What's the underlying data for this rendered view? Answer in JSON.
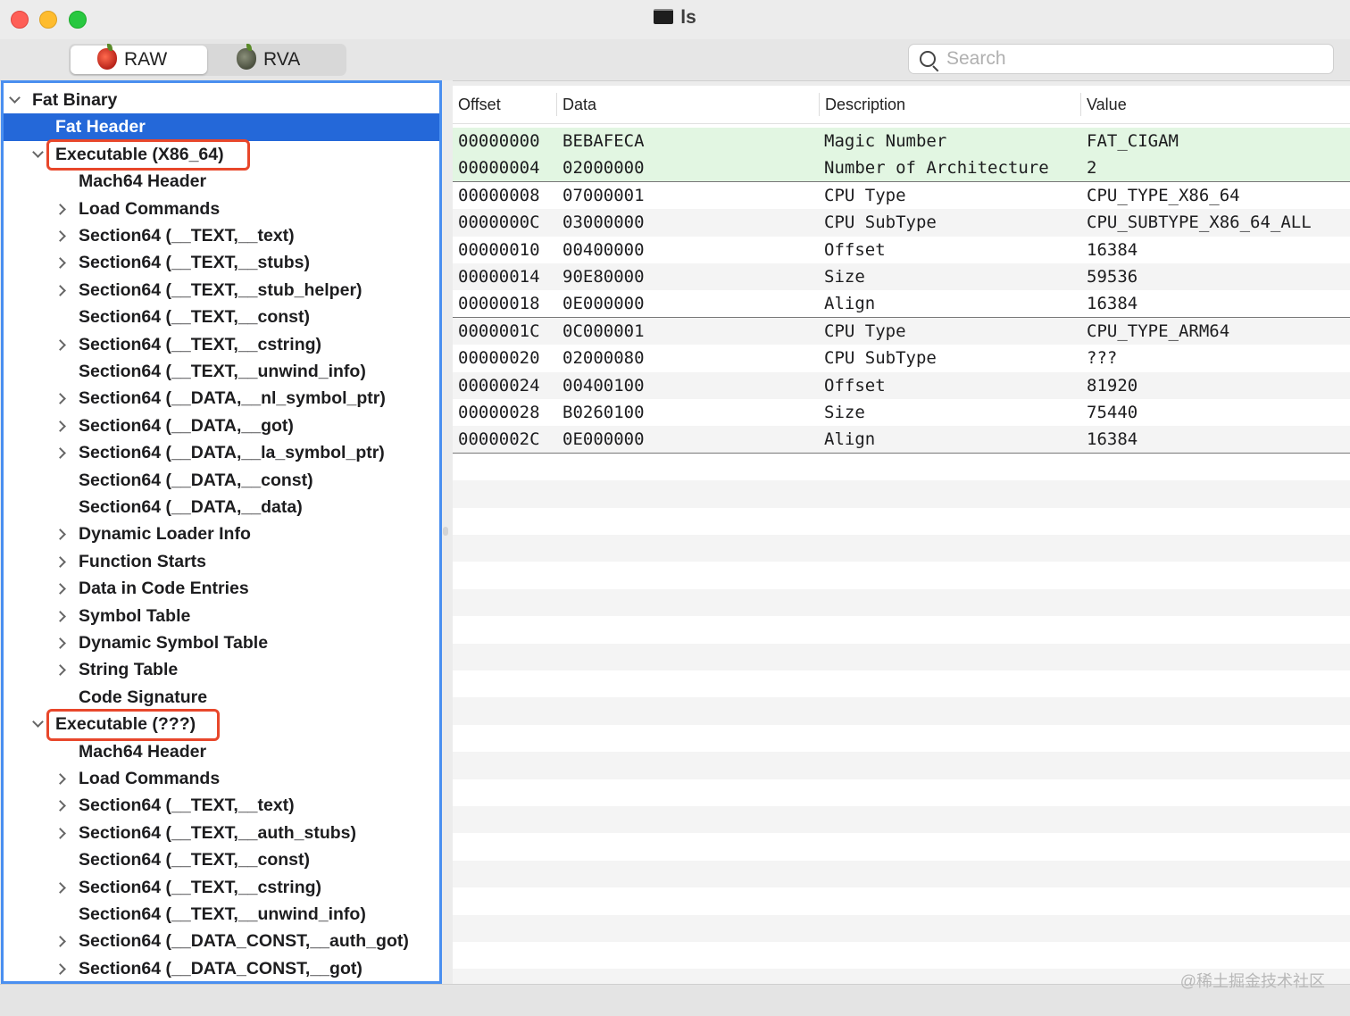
{
  "window": {
    "title": "ls"
  },
  "toolbar": {
    "raw_label": "RAW",
    "rva_label": "RVA",
    "search_placeholder": "Search"
  },
  "sidebar": {
    "items": [
      {
        "label": "Fat Binary",
        "expander": "down"
      },
      {
        "label": "Fat Header",
        "expander": "none",
        "selected": true
      },
      {
        "label": "Executable  (X86_64)",
        "expander": "down",
        "highlighted": true
      },
      {
        "label": "Mach64 Header",
        "expander": "none"
      },
      {
        "label": "Load Commands",
        "expander": "right"
      },
      {
        "label": "Section64 (__TEXT,__text)",
        "expander": "right"
      },
      {
        "label": "Section64 (__TEXT,__stubs)",
        "expander": "right"
      },
      {
        "label": "Section64 (__TEXT,__stub_helper)",
        "expander": "right"
      },
      {
        "label": "Section64 (__TEXT,__const)",
        "expander": "none"
      },
      {
        "label": "Section64 (__TEXT,__cstring)",
        "expander": "right"
      },
      {
        "label": "Section64 (__TEXT,__unwind_info)",
        "expander": "none"
      },
      {
        "label": "Section64 (__DATA,__nl_symbol_ptr)",
        "expander": "right"
      },
      {
        "label": "Section64 (__DATA,__got)",
        "expander": "right"
      },
      {
        "label": "Section64 (__DATA,__la_symbol_ptr)",
        "expander": "right"
      },
      {
        "label": "Section64 (__DATA,__const)",
        "expander": "none"
      },
      {
        "label": "Section64 (__DATA,__data)",
        "expander": "none"
      },
      {
        "label": "Dynamic Loader Info",
        "expander": "right"
      },
      {
        "label": "Function Starts",
        "expander": "right"
      },
      {
        "label": "Data in Code Entries",
        "expander": "right"
      },
      {
        "label": "Symbol Table",
        "expander": "right"
      },
      {
        "label": "Dynamic Symbol Table",
        "expander": "right"
      },
      {
        "label": "String Table",
        "expander": "right"
      },
      {
        "label": "Code Signature",
        "expander": "none"
      },
      {
        "label": "Executable  (???)",
        "expander": "down",
        "highlighted": true
      },
      {
        "label": "Mach64 Header",
        "expander": "none"
      },
      {
        "label": "Load Commands",
        "expander": "right"
      },
      {
        "label": "Section64 (__TEXT,__text)",
        "expander": "right"
      },
      {
        "label": "Section64 (__TEXT,__auth_stubs)",
        "expander": "right"
      },
      {
        "label": "Section64 (__TEXT,__const)",
        "expander": "none"
      },
      {
        "label": "Section64 (__TEXT,__cstring)",
        "expander": "right"
      },
      {
        "label": "Section64 (__TEXT,__unwind_info)",
        "expander": "none"
      },
      {
        "label": "Section64 (__DATA_CONST,__auth_got)",
        "expander": "right"
      },
      {
        "label": "Section64 (__DATA_CONST,__got)",
        "expander": "right"
      }
    ]
  },
  "table": {
    "columns": [
      "Offset",
      "Data",
      "Description",
      "Value"
    ],
    "rows": [
      {
        "offset": "00000000",
        "data": "BEBAFECA",
        "description": "Magic Number",
        "value": "FAT_CIGAM",
        "highlight": "green"
      },
      {
        "offset": "00000004",
        "data": "02000000",
        "description": "Number of Architecture",
        "value": "2",
        "highlight": "green",
        "group_end": true
      },
      {
        "offset": "00000008",
        "data": "07000001",
        "description": "CPU Type",
        "value": "CPU_TYPE_X86_64"
      },
      {
        "offset": "0000000C",
        "data": "03000000",
        "description": "CPU SubType",
        "value": "CPU_SUBTYPE_X86_64_ALL"
      },
      {
        "offset": "00000010",
        "data": "00400000",
        "description": "Offset",
        "value": "16384"
      },
      {
        "offset": "00000014",
        "data": "90E80000",
        "description": "Size",
        "value": "59536"
      },
      {
        "offset": "00000018",
        "data": "0E000000",
        "description": "Align",
        "value": "16384",
        "group_end": true
      },
      {
        "offset": "0000001C",
        "data": "0C000001",
        "description": "CPU Type",
        "value": "CPU_TYPE_ARM64"
      },
      {
        "offset": "00000020",
        "data": "02000080",
        "description": "CPU SubType",
        "value": "???"
      },
      {
        "offset": "00000024",
        "data": "00400100",
        "description": "Offset",
        "value": "81920"
      },
      {
        "offset": "00000028",
        "data": "B0260100",
        "description": "Size",
        "value": "75440"
      },
      {
        "offset": "0000002C",
        "data": "0E000000",
        "description": "Align",
        "value": "16384",
        "group_end": true
      }
    ]
  },
  "watermark": "@稀土掘金技术社区",
  "colors": {
    "selection": "#2468d9",
    "highlight_box": "#e8472b",
    "sidebar_border": "#4a8ff0",
    "green_row": "#e2f6e2"
  }
}
